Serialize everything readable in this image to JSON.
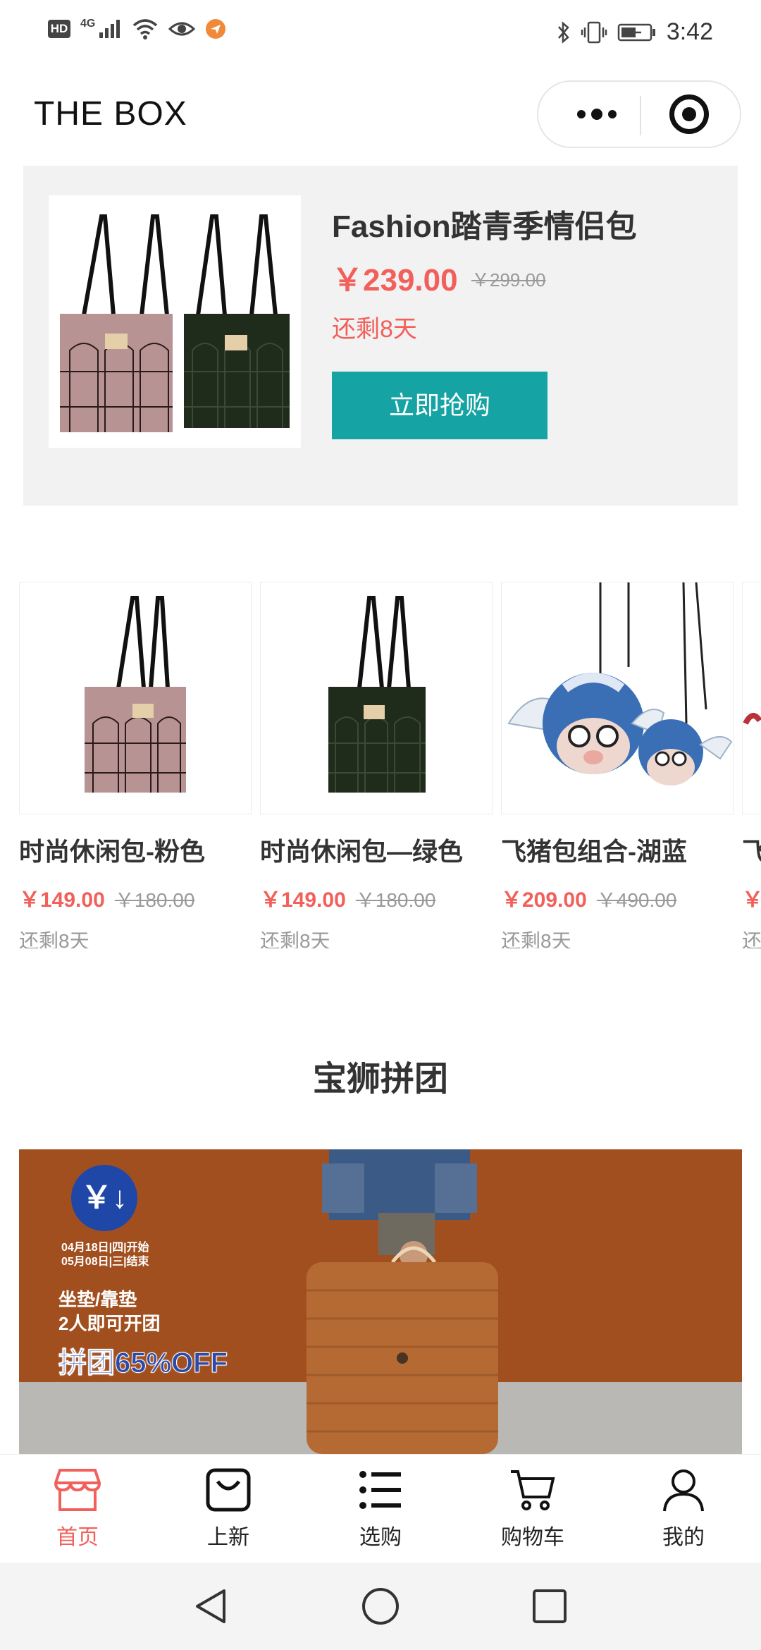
{
  "status_bar": {
    "hd": "HD",
    "network": "4G",
    "time": "3:42"
  },
  "header": {
    "title": "THE BOX",
    "more_icon": "more-dots-icon",
    "close_icon": "target-circle-icon"
  },
  "featured": {
    "title": "Fashion踏青季情侣包",
    "price": "￥239.00",
    "original_price": "￥299.00",
    "remaining": "还剩8天",
    "button": "立即抢购"
  },
  "products": [
    {
      "title": "时尚休闲包-粉色",
      "price": "￥149.00",
      "original_price": "￥180.00",
      "remaining": "还剩8天"
    },
    {
      "title": "时尚休闲包—绿色",
      "price": "￥149.00",
      "original_price": "￥180.00",
      "remaining": "还剩8天"
    },
    {
      "title": "飞猪包组合-湖蓝",
      "price": "￥209.00",
      "original_price": "￥490.00",
      "remaining": "还剩8天"
    },
    {
      "title": "飞",
      "price": "￥",
      "original_price": "",
      "remaining": "还"
    }
  ],
  "group_section": {
    "title": "宝狮拼团",
    "banner": {
      "badge": "￥↓",
      "dates_line1": "04月18日|四|开始",
      "dates_line2": "05月08日|三|结束",
      "text_line1": "坐垫/靠垫",
      "text_line2": "2人即可开团",
      "promo": "拼团65%OFF"
    }
  },
  "tabbar": {
    "items": [
      {
        "label": "首页",
        "icon": "shop-icon",
        "active": true
      },
      {
        "label": "上新",
        "icon": "bag-icon",
        "active": false
      },
      {
        "label": "选购",
        "icon": "list-icon",
        "active": false
      },
      {
        "label": "购物车",
        "icon": "cart-icon",
        "active": false
      },
      {
        "label": "我的",
        "icon": "user-icon",
        "active": false
      }
    ]
  },
  "colors": {
    "accent": "#f2605b",
    "button": "#16a3a3",
    "banner": "#a14f1f"
  }
}
